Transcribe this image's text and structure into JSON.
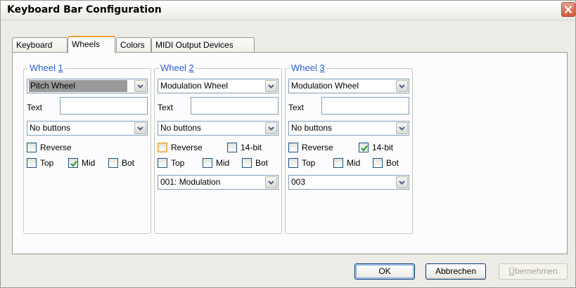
{
  "window": {
    "title": "Keyboard Bar Configuration"
  },
  "tabs": [
    {
      "label": "Keyboard",
      "active": false
    },
    {
      "label": "Wheels",
      "active": true
    },
    {
      "label": "Colors",
      "active": false
    },
    {
      "label": "MIDI Output Devices",
      "active": false
    }
  ],
  "wheels": [
    {
      "title_prefix": "Wheel ",
      "title_number": "1",
      "type": "Pitch Wheel",
      "text_label": "Text",
      "text_value": "",
      "buttons": "No buttons",
      "reverse": {
        "label": "Reverse",
        "checked": false
      },
      "top": {
        "label": "Top",
        "checked": false
      },
      "mid": {
        "label": "Mid",
        "checked": true
      },
      "bot": {
        "label": "Bot",
        "checked": false
      }
    },
    {
      "title_prefix": "Wheel ",
      "title_number": "2",
      "type": "Modulation Wheel",
      "text_label": "Text",
      "text_value": "",
      "buttons": "No buttons",
      "reverse": {
        "label": "Reverse",
        "checked": false
      },
      "fourteen_bit": {
        "label": "14-bit",
        "checked": false
      },
      "top": {
        "label": "Top",
        "checked": false
      },
      "mid": {
        "label": "Mid",
        "checked": false
      },
      "bot": {
        "label": "Bot",
        "checked": false
      },
      "controller": "001: Modulation"
    },
    {
      "title_prefix": "Wheel ",
      "title_number": "3",
      "type": "Modulation Wheel",
      "text_label": "Text",
      "text_value": "",
      "buttons": "No buttons",
      "reverse": {
        "label": "Reverse",
        "checked": false
      },
      "fourteen_bit": {
        "label": "14-bit",
        "checked": true
      },
      "top": {
        "label": "Top",
        "checked": false
      },
      "mid": {
        "label": "Mid",
        "checked": false
      },
      "bot": {
        "label": "Bot",
        "checked": false
      },
      "controller": "003"
    }
  ],
  "footer": {
    "ok": "OK",
    "cancel": "Abbrechen",
    "apply_mnemonic": "Ü",
    "apply_rest": "bernehmen"
  },
  "colors": {
    "group_title": "#2d5fcf",
    "check_mark": "#21a121",
    "default_button_border": "#003c74"
  }
}
